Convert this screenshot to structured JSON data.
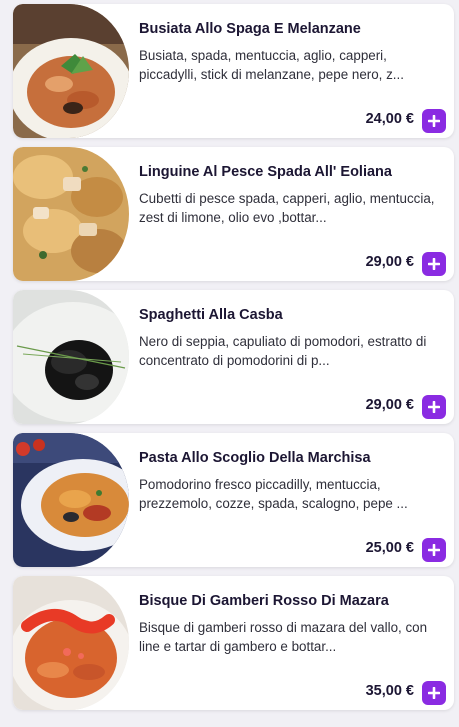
{
  "accent_color": "#8a2be2",
  "add_icon": "plus-icon",
  "items": [
    {
      "name": "Busiata Allo Spaga E Melanzane",
      "description": "Busiata, spada, mentuccia, aglio, capperi, piccadylli, stick di melanzane, pepe nero, z...",
      "price": "24,00 €"
    },
    {
      "name": "Linguine Al Pesce Spada All' Eoliana",
      "description": "Cubetti di pesce spada, capperi, aglio, mentuccia, zest di limone, olio evo ,bottar...",
      "price": "29,00 €"
    },
    {
      "name": "Spaghetti Alla Casba",
      "description": "Nero di seppia, capuliato di pomodori, estratto di concentrato di pomodorini di p...",
      "price": "29,00 €"
    },
    {
      "name": "Pasta Allo Scoglio Della Marchisa",
      "description": "Pomodorino fresco piccadilly, mentuccia, prezzemolo, cozze, spada, scalogno, pepe ...",
      "price": "25,00 €"
    },
    {
      "name": "Bisque Di Gamberi Rosso Di Mazara",
      "description": "Bisque di gamberi rosso di mazara del vallo, con line e tartar di gambero e bottar...",
      "price": "35,00 €"
    }
  ]
}
